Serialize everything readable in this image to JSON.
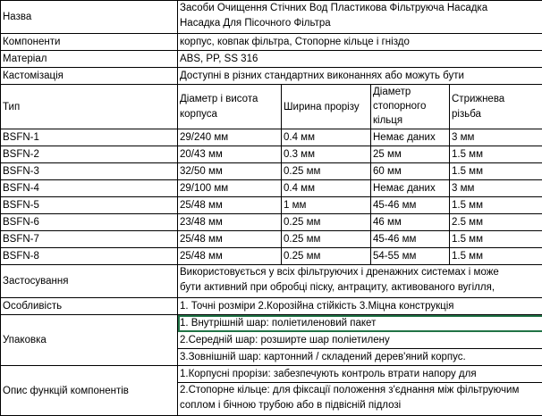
{
  "rows": {
    "name": {
      "label": "Назва",
      "value_lines": [
        "Засоби Очищення Стічних Вод Пластикова Фільтруюча Насадка",
        "Насадка Для Пісочного Фільтра"
      ]
    },
    "components": {
      "label": "Компоненти",
      "value": "корпус, ковпак фільтра, Стопорне кільце і гніздо"
    },
    "material": {
      "label": "Матеріал",
      "value": "ABS, PP, SS 316"
    },
    "customization": {
      "label": "Кастомізація",
      "value": "Доступні в різних стандартних виконаннях або можуть бути"
    }
  },
  "type_table": {
    "label": "Тип",
    "headers": {
      "diameter": [
        "Діаметр і висота",
        "корпусa"
      ],
      "slot": "Ширина прорізу",
      "ring": [
        "Діаметр",
        "стопорного",
        "кільця"
      ],
      "thread": [
        "Стрижнева",
        "різьба"
      ]
    },
    "items": [
      {
        "type": "BSFN-1",
        "diameter": "29/240 мм",
        "slot": "0.4 мм",
        "ring": "Немає даних",
        "thread": "3 мм"
      },
      {
        "type": "BSFN-2",
        "diameter": "20/43 мм",
        "slot": "0.3 мм",
        "ring": "25 мм",
        "thread": "1.5 мм"
      },
      {
        "type": "BSFN-3",
        "diameter": "32/50 мм",
        "slot": "0.25 мм",
        "ring": "60 мм",
        "thread": "1.5 мм"
      },
      {
        "type": "BSFN-4",
        "diameter": "29/100 мм",
        "slot": "0.4 мм",
        "ring": "Немає даних",
        "thread": "3 мм"
      },
      {
        "type": "BSFN-5",
        "diameter": "25/48 мм",
        "slot": "1 мм",
        "ring": "45-46 мм",
        "thread": "1.5 мм"
      },
      {
        "type": "BSFN-6",
        "diameter": "23/48 мм",
        "slot": "0.25 мм",
        "ring": "46 мм",
        "thread": "2.5 мм"
      },
      {
        "type": "BSFN-7",
        "diameter": "25/48 мм",
        "slot": "0.25 мм",
        "ring": "45-46 мм",
        "thread": "1.5 мм"
      },
      {
        "type": "BSFN-8",
        "diameter": "25/48 мм",
        "slot": "0.25 мм",
        "ring": "54-55 мм",
        "thread": "1.5 мм"
      }
    ]
  },
  "application": {
    "label": "Застосування",
    "value_lines": [
      "Використовується у всіх фільтруючих і дренажних системах і може",
      "бути активний при обробці піску, антрациту, активованого вугілля,"
    ]
  },
  "feature": {
    "label": "Особливість",
    "value": "1. Точні розміри 2.Корозійна стійкість 3.Міцна конструкція"
  },
  "packaging": {
    "label": "Упаковка",
    "lines": [
      "1. Внутрішній шар: поліетиленовий пакет",
      "2.Середній шар: розширте шар поліетилену",
      "3.Зовнішній шар: картонний / складений дерев'яний корпус."
    ]
  },
  "functions": {
    "label": "Опис функцій компонентів",
    "line1": "1.Корпусні прорізи: забезпечують контроль втрати напору для",
    "line2": [
      "2.Стопорне кільце: для фіксації положення з'єднання між фільтруючим",
      "соплом і бічною трубою або в підвісній підлозі"
    ]
  }
}
